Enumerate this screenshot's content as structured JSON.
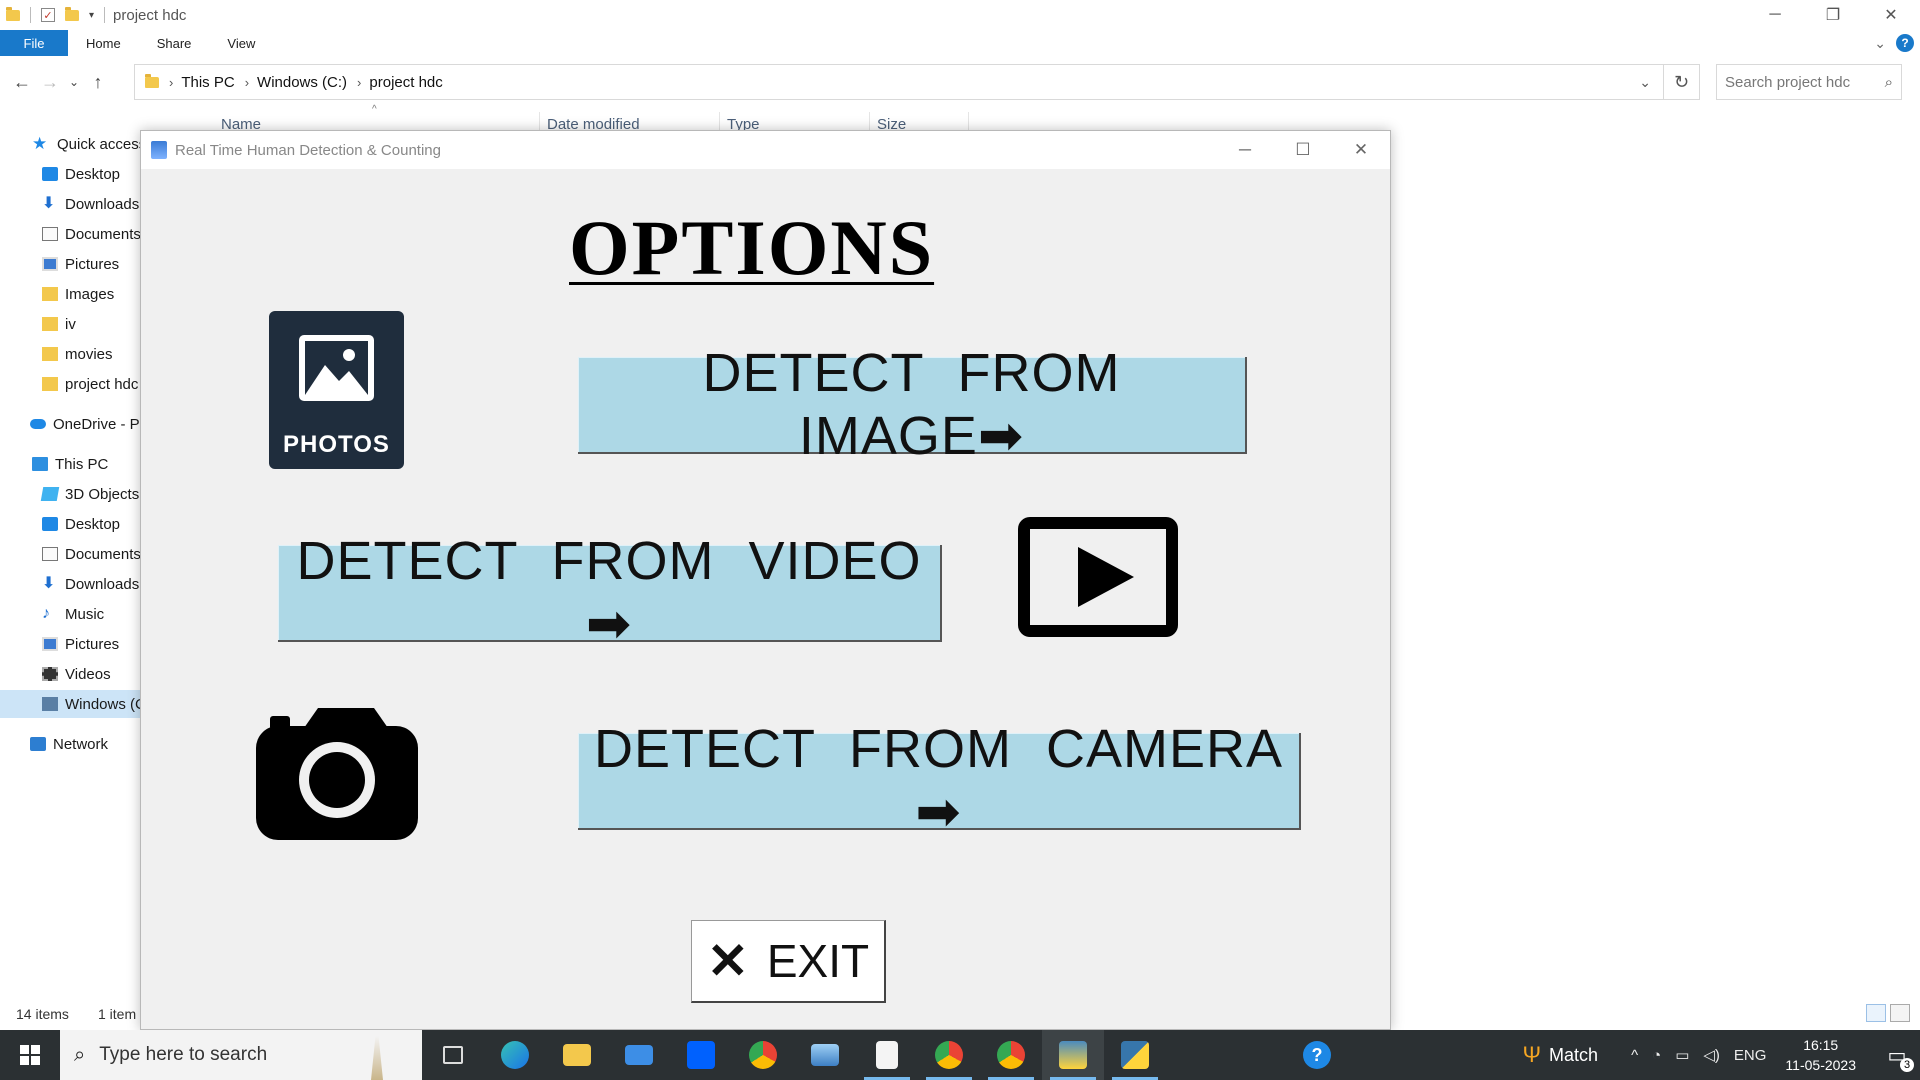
{
  "explorer": {
    "title": "project hdc",
    "ribbon_tabs": [
      "File",
      "Home",
      "Share",
      "View"
    ],
    "breadcrumb": [
      "This PC",
      "Windows (C:)",
      "project hdc"
    ],
    "search_placeholder": "Search project hdc",
    "columns": [
      "Name",
      "Date modified",
      "Type",
      "Size"
    ],
    "nav": {
      "quick_access": "Quick access",
      "qa_items": [
        "Desktop",
        "Downloads",
        "Documents",
        "Pictures",
        "Images",
        "iv",
        "movies",
        "project hdc"
      ],
      "onedrive": "OneDrive - P",
      "this_pc": "This PC",
      "pc_items": [
        "3D Objects",
        "Desktop",
        "Documents",
        "Downloads",
        "Music",
        "Pictures",
        "Videos",
        "Windows (C"
      ],
      "network": "Network"
    },
    "status_count": "14 items",
    "status_selected": "1 item"
  },
  "app": {
    "title": "Real Time Human Detection & Counting",
    "heading": "OPTIONS",
    "btn_image": "DETECT FROM IMAGE➡",
    "btn_video": "DETECT FROM VIDEO ➡",
    "btn_camera": "DETECT FROM CAMERA ➡",
    "photos_label": "PHOTOS",
    "exit_label": "EXIT",
    "exit_icon": "✕"
  },
  "taskbar": {
    "search_placeholder": "Type here to search",
    "match_label": "Match",
    "language": "ENG",
    "time": "16:15",
    "date": "11-05-2023",
    "notification_count": "3"
  },
  "colors": {
    "button_bg": "#add8e6",
    "app_bg": "#f0f0f0",
    "accent": "#1979ca",
    "taskbar": "#2b3033"
  }
}
